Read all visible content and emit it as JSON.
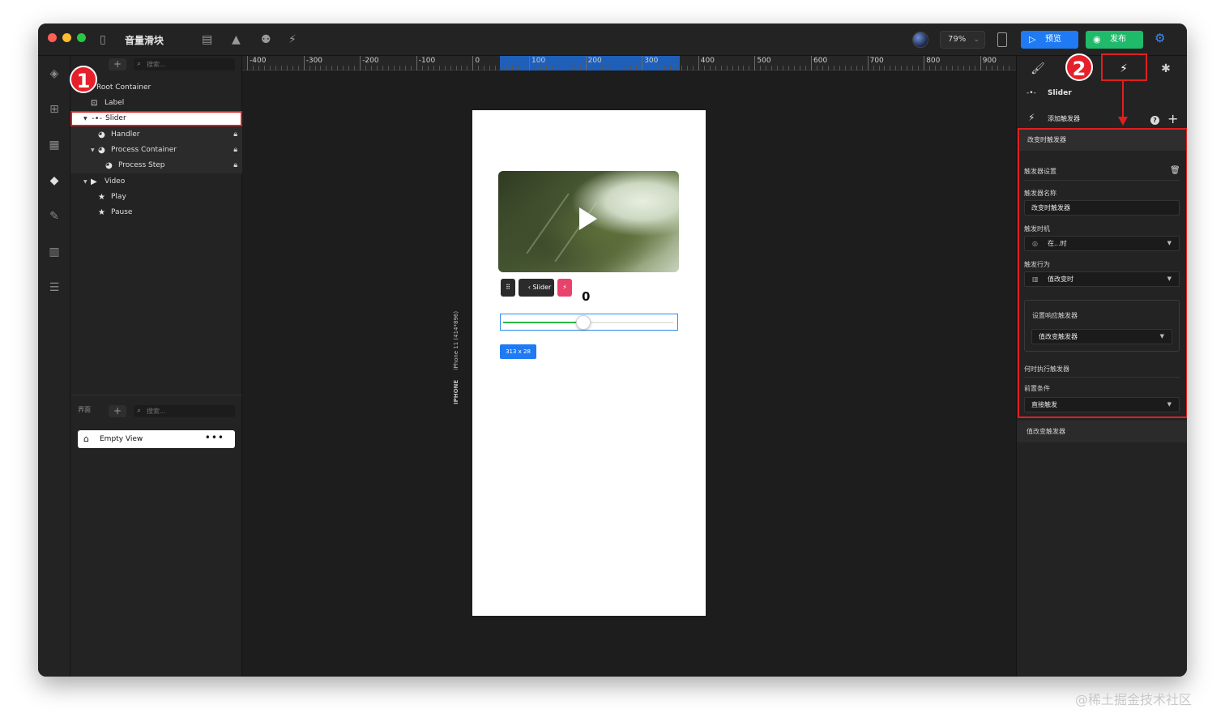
{
  "app": {
    "title": "音量滑块",
    "zoom": "79%",
    "preview_label": "预览",
    "publish_label": "发布",
    "colors": {
      "preview": "#1f7af3",
      "publish": "#1fba6a",
      "highlight_red": "#e01f1f"
    }
  },
  "layers": {
    "search_placeholder": "搜索...",
    "items": [
      {
        "label": "Root Container",
        "icon": "none"
      },
      {
        "label": "Label",
        "icon": "text-box-icon"
      },
      {
        "label": "Slider",
        "icon": "slider-icon",
        "selected": true
      },
      {
        "label": "Handler",
        "icon": "component-icon",
        "locked": true
      },
      {
        "label": "Process Container",
        "icon": "component-icon",
        "locked": true
      },
      {
        "label": "Process Step",
        "icon": "component-icon",
        "locked": true
      },
      {
        "label": "Video",
        "icon": "video-icon"
      },
      {
        "label": "Play",
        "icon": "star-icon"
      },
      {
        "label": "Pause",
        "icon": "star-icon"
      }
    ]
  },
  "pages": {
    "label": "界面",
    "search_placeholder": "搜索...",
    "items": [
      {
        "label": "Empty View",
        "icon": "home-icon",
        "more": "•••"
      }
    ]
  },
  "badges": {
    "one": "1",
    "two": "2"
  },
  "ruler": {
    "labels": [
      "-400",
      "-300",
      "-200",
      "-100",
      "0",
      "100",
      "200",
      "300",
      "400",
      "500",
      "600",
      "700",
      "800",
      "900"
    ]
  },
  "canvas": {
    "device_name": "IPHONE",
    "device_size": "iPhone 11 (414*896)",
    "slider_tag": "Slider",
    "value": "0",
    "size_label": "313 x 28",
    "slider_progress": 0.47
  },
  "inspector": {
    "component_name": "Slider",
    "add_trigger": "添加触发器",
    "help": "?",
    "trigger": {
      "header": "改变时触发器",
      "settings_label": "触发器设置",
      "name_label": "触发器名称",
      "name_value": "改变时触发器",
      "timing_label": "触发时机",
      "timing_value": "在...时",
      "action_label": "触发行为",
      "action_value": "值改变时",
      "response_label": "设置响应触发器",
      "response_value": "值改变触发器",
      "when_label": "何时执行触发器",
      "precondition_label": "前置条件",
      "precondition_value": "直接触发"
    },
    "footer_trigger": "值改变触发器"
  },
  "watermark": "@稀土掘金技术社区"
}
